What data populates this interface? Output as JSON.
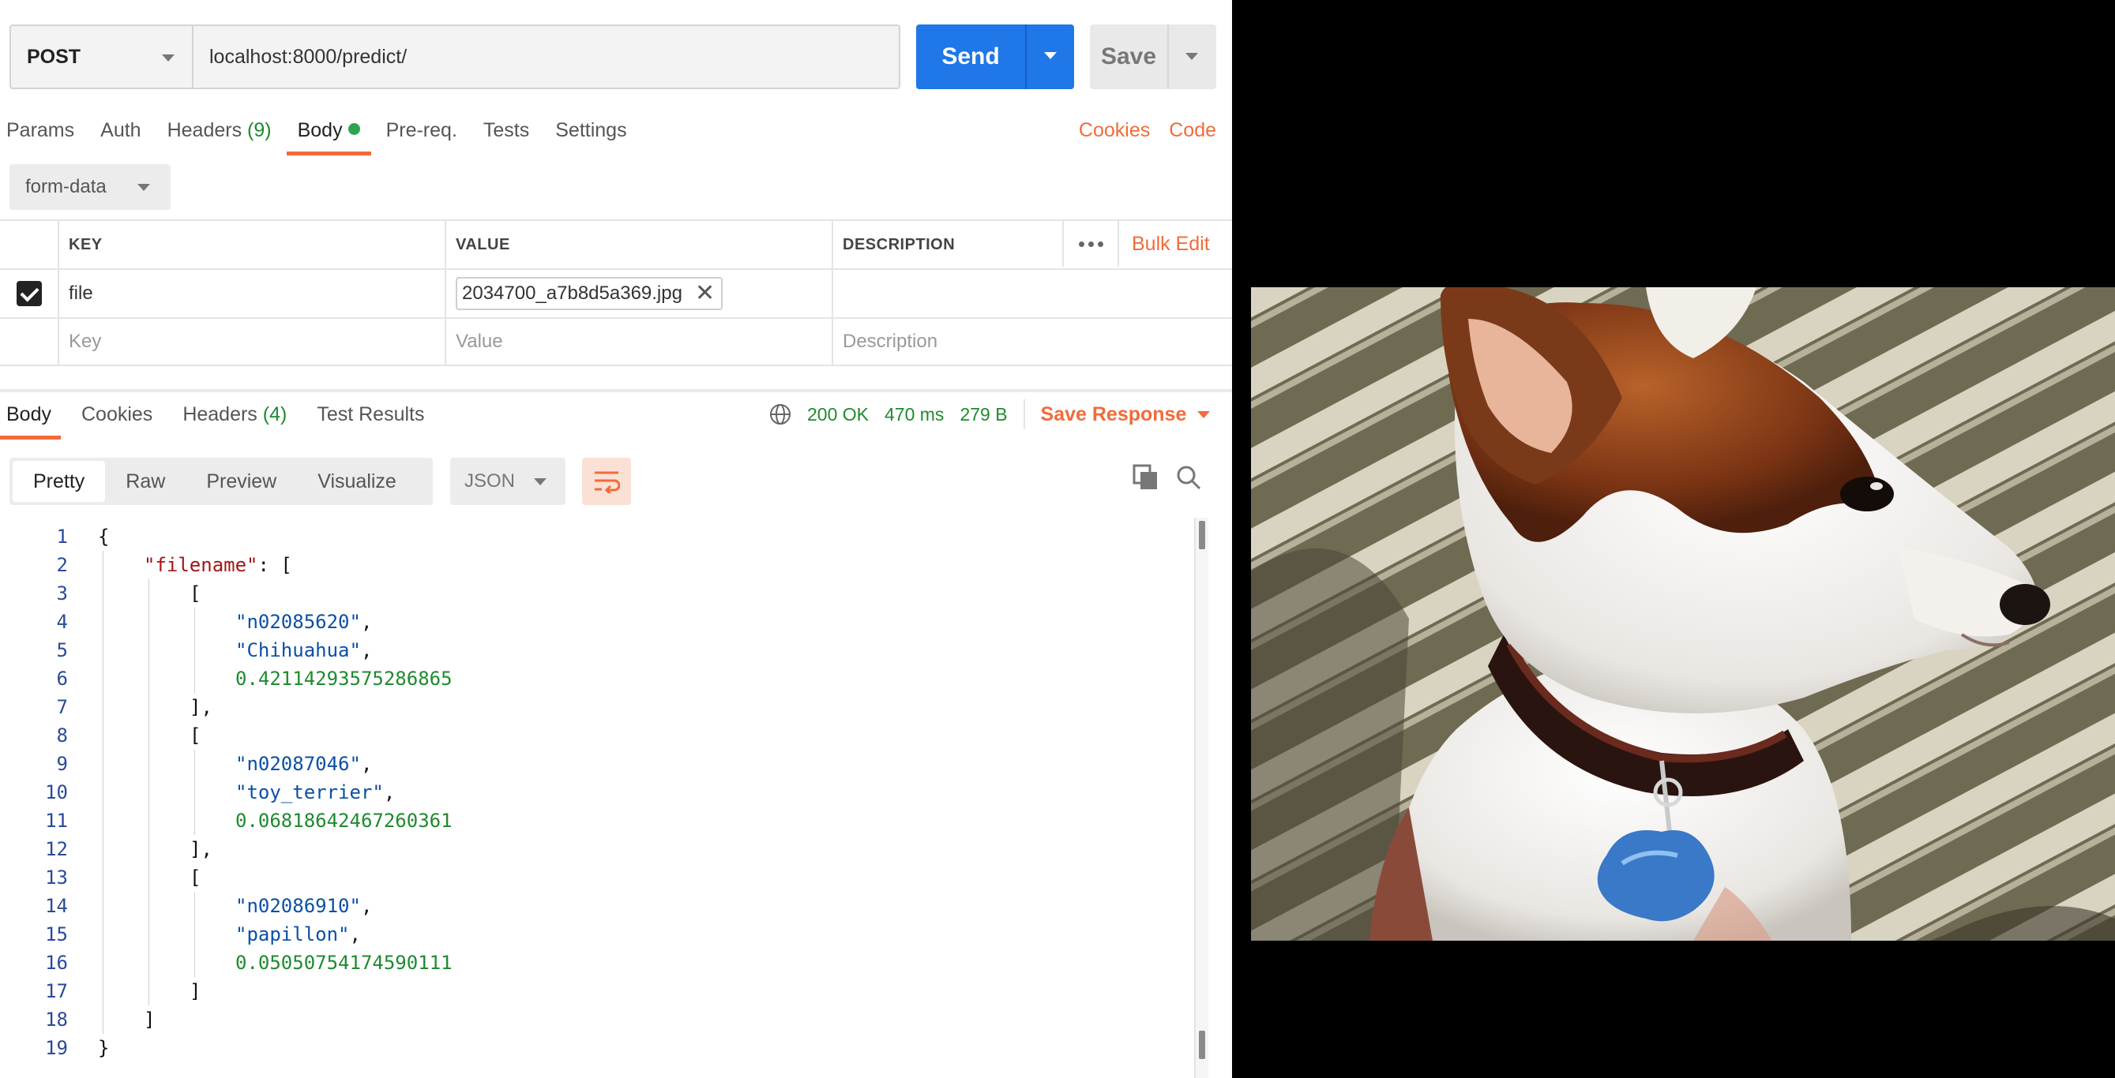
{
  "request": {
    "method": "POST",
    "url": "localhost:8000/predict/",
    "send_label": "Send",
    "save_label": "Save"
  },
  "request_tabs": [
    {
      "label": "Params"
    },
    {
      "label": "Auth"
    },
    {
      "label": "Headers",
      "count": "(9)"
    },
    {
      "label": "Body"
    },
    {
      "label": "Pre-req."
    },
    {
      "label": "Tests"
    },
    {
      "label": "Settings"
    }
  ],
  "request_links": {
    "cookies": "Cookies",
    "code": "Code"
  },
  "body_type": "form-data",
  "form_table": {
    "headers": {
      "key": "KEY",
      "value": "VALUE",
      "description": "DESCRIPTION",
      "bulk_edit": "Bulk Edit"
    },
    "row": {
      "key": "file",
      "file_name": "2034700_a7b8d5a369.jpg"
    },
    "placeholders": {
      "key": "Key",
      "value": "Value",
      "description": "Description"
    }
  },
  "response_tabs": [
    {
      "label": "Body"
    },
    {
      "label": "Cookies"
    },
    {
      "label": "Headers",
      "count": "(4)"
    },
    {
      "label": "Test Results"
    }
  ],
  "response_status": {
    "status": "200 OK",
    "time": "470 ms",
    "size": "279 B",
    "save_response": "Save Response"
  },
  "view_modes": [
    "Pretty",
    "Raw",
    "Preview",
    "Visualize"
  ],
  "format": "JSON",
  "code_lines": [
    {
      "n": "1",
      "indent": 0,
      "tokens": [
        [
          "p",
          "{"
        ]
      ]
    },
    {
      "n": "2",
      "indent": 1,
      "tokens": [
        [
          "k",
          "\"filename\""
        ],
        [
          "p",
          ": ["
        ]
      ]
    },
    {
      "n": "3",
      "indent": 2,
      "tokens": [
        [
          "p",
          "["
        ]
      ]
    },
    {
      "n": "4",
      "indent": 3,
      "tokens": [
        [
          "s",
          "\"n02085620\""
        ],
        [
          "p",
          ","
        ]
      ]
    },
    {
      "n": "5",
      "indent": 3,
      "tokens": [
        [
          "s",
          "\"Chihuahua\""
        ],
        [
          "p",
          ","
        ]
      ]
    },
    {
      "n": "6",
      "indent": 3,
      "tokens": [
        [
          "n",
          "0.42114293575286865"
        ]
      ]
    },
    {
      "n": "7",
      "indent": 2,
      "tokens": [
        [
          "p",
          "],"
        ]
      ]
    },
    {
      "n": "8",
      "indent": 2,
      "tokens": [
        [
          "p",
          "["
        ]
      ]
    },
    {
      "n": "9",
      "indent": 3,
      "tokens": [
        [
          "s",
          "\"n02087046\""
        ],
        [
          "p",
          ","
        ]
      ]
    },
    {
      "n": "10",
      "indent": 3,
      "tokens": [
        [
          "s",
          "\"toy_terrier\""
        ],
        [
          "p",
          ","
        ]
      ]
    },
    {
      "n": "11",
      "indent": 3,
      "tokens": [
        [
          "n",
          "0.06818642467260361"
        ]
      ]
    },
    {
      "n": "12",
      "indent": 2,
      "tokens": [
        [
          "p",
          "],"
        ]
      ]
    },
    {
      "n": "13",
      "indent": 2,
      "tokens": [
        [
          "p",
          "["
        ]
      ]
    },
    {
      "n": "14",
      "indent": 3,
      "tokens": [
        [
          "s",
          "\"n02086910\""
        ],
        [
          "p",
          ","
        ]
      ]
    },
    {
      "n": "15",
      "indent": 3,
      "tokens": [
        [
          "s",
          "\"papillon\""
        ],
        [
          "p",
          ","
        ]
      ]
    },
    {
      "n": "16",
      "indent": 3,
      "tokens": [
        [
          "n",
          "0.05050754174590111"
        ]
      ]
    },
    {
      "n": "17",
      "indent": 2,
      "tokens": [
        [
          "p",
          "]"
        ]
      ]
    },
    {
      "n": "18",
      "indent": 1,
      "tokens": [
        [
          "p",
          "]"
        ]
      ]
    },
    {
      "n": "19",
      "indent": 0,
      "tokens": [
        [
          "p",
          "}"
        ]
      ]
    }
  ],
  "colors": {
    "accent": "#f26b3a",
    "send": "#1f77e8",
    "status_ok": "#1f8a2f",
    "json_key": "#a31515",
    "json_string": "#0b4fa6",
    "json_number": "#1f8a2f"
  },
  "icons": [
    "chevron-down-icon",
    "check-icon",
    "close-icon",
    "more-horizontal-icon",
    "globe-icon",
    "wrap-lines-icon",
    "copy-icon",
    "search-icon"
  ],
  "image": {
    "subject": "dog photo"
  }
}
